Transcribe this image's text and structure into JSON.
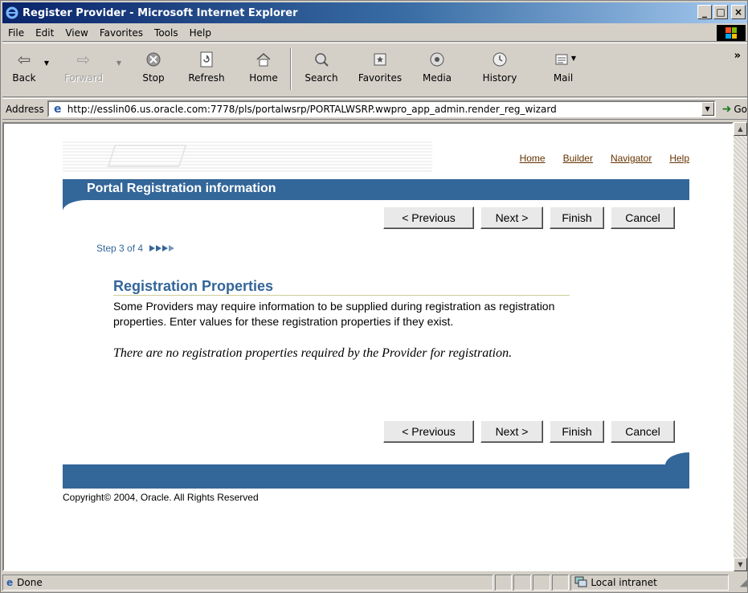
{
  "window": {
    "title": "Register Provider - Microsoft Internet Explorer",
    "controls": [
      "_",
      "□",
      "×"
    ]
  },
  "menu": [
    "File",
    "Edit",
    "View",
    "Favorites",
    "Tools",
    "Help"
  ],
  "toolbar": {
    "back": "Back",
    "forward": "Forward",
    "stop": "Stop",
    "refresh": "Refresh",
    "home": "Home",
    "search": "Search",
    "favorites": "Favorites",
    "media": "Media",
    "history": "History",
    "mail": "Mail",
    "more": "»"
  },
  "address": {
    "label": "Address",
    "url": "http://esslin06.us.oracle.com:7778/pls/portalwsrp/PORTALWSRP.wwpro_app_admin.render_reg_wizard",
    "go": "Go"
  },
  "page": {
    "links": [
      "Home",
      "Builder",
      "Navigator",
      "Help"
    ],
    "heading": "Portal Registration information",
    "buttons": {
      "previous": "< Previous",
      "next": "Next >",
      "finish": "Finish",
      "cancel": "Cancel"
    },
    "step": "Step 3 of 4",
    "section_title": "Registration Properties",
    "description": "Some Providers may require information to be supplied during registration as registration properties. Enter values for these registration properties if they exist.",
    "note": "There are no registration properties required by the Provider for registration.",
    "copyright": "Copyright© 2004, Oracle. All Rights Reserved"
  },
  "status": {
    "text": "Done",
    "zone": "Local intranet"
  }
}
